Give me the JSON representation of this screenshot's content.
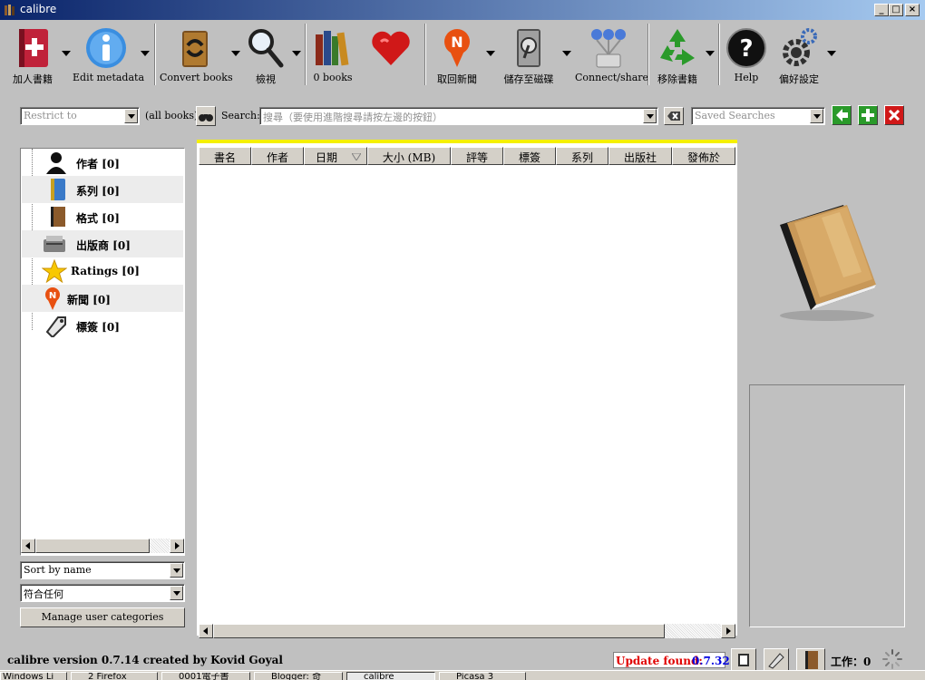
{
  "window": {
    "title": "calibre",
    "minimize_glyph": "_",
    "maximize_glyph": "□",
    "close_glyph": "×"
  },
  "toolbar": {
    "add_books": "加人書籍",
    "edit_metadata": "Edit metadata",
    "convert_books": "Convert books",
    "view": "檢視",
    "library": "0 books",
    "fetch_news": "取回新聞",
    "save_to_disk": "儲存至磁碟",
    "connect_share": "Connect/share",
    "remove_books": "移除書籍",
    "help": "Help",
    "preferences": "偏好設定",
    "news_badge": "N"
  },
  "search": {
    "restrict_placeholder": "Restrict to",
    "all_books": "(all books)",
    "search_label": "Search:",
    "search_placeholder": "搜尋（要使用進階搜尋請按左邊的按鈕）",
    "saved_searches_placeholder": "Saved Searches"
  },
  "tag_browser": {
    "items": [
      {
        "label": "作者 [0]",
        "icon": "person-icon"
      },
      {
        "label": "系列 [0]",
        "icon": "series-icon"
      },
      {
        "label": "格式 [0]",
        "icon": "format-icon"
      },
      {
        "label": "出版商 [0]",
        "icon": "publisher-icon"
      },
      {
        "label": "Ratings [0]",
        "icon": "star-icon"
      },
      {
        "label": "新聞 [0]",
        "icon": "news-icon"
      },
      {
        "label": "標簽 [0]",
        "icon": "tag-icon"
      }
    ],
    "sort_by": "Sort by name",
    "match": "符合任何",
    "manage_categories": "Manage user categories"
  },
  "book_table": {
    "columns": [
      "書名",
      "作者",
      "日期",
      "大小 (MB)",
      "評等",
      "標簽",
      "系列",
      "出版社",
      "發佈於"
    ]
  },
  "status_bar": {
    "version": "calibre version 0.7.14 created by Kovid Goyal",
    "update_label": "Update found:",
    "update_version": "0.7.32",
    "jobs": "工作：0"
  },
  "taskbar": {
    "items": [
      "Windows Li",
      "2 Firefox",
      "0001電子書",
      "Blogger: 奇",
      "calibre",
      "Picasa 3"
    ]
  },
  "colors": {
    "title_gradient_start": "#0a246a",
    "title_gradient_end": "#a6caf0",
    "table_highlight": "#f5f000",
    "update_label": "#e00000",
    "update_version": "#0000e0"
  }
}
